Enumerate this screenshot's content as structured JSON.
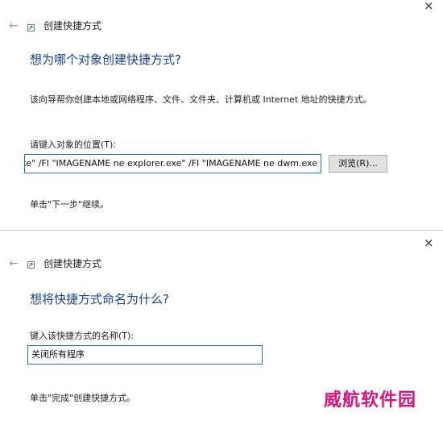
{
  "dialog1": {
    "title": "创建快捷方式",
    "heading": "想为哪个对象创建快捷方式?",
    "description": "该向导帮你创建本地或网络程序、文件、文件夹、计算机或 Internet 地址的快捷方式。",
    "location_label": "请键入对象的位置(T):",
    "location_value": "\"IMAGENAME ne dwm.exe\" /FI \"IMAGENAME ne explorer.exe\" /FI \"IMAGENAME ne dwm.exe",
    "browse_button": "浏览(R)...",
    "hint": "单击\"下一步\"继续。"
  },
  "dialog2": {
    "title": "创建快捷方式",
    "heading": "想将快捷方式命名为什么?",
    "name_label": "键入该快捷方式的名称(T):",
    "name_value": "关闭所有程序",
    "hint": "单击\"完成\"创建快捷方式。"
  },
  "icons": {
    "close": "×",
    "back": "←"
  },
  "watermark": "威航软件园",
  "colors": {
    "heading": "#1b3f8f",
    "focus_border": "#2b6fc2",
    "watermark": "#d5147e"
  }
}
